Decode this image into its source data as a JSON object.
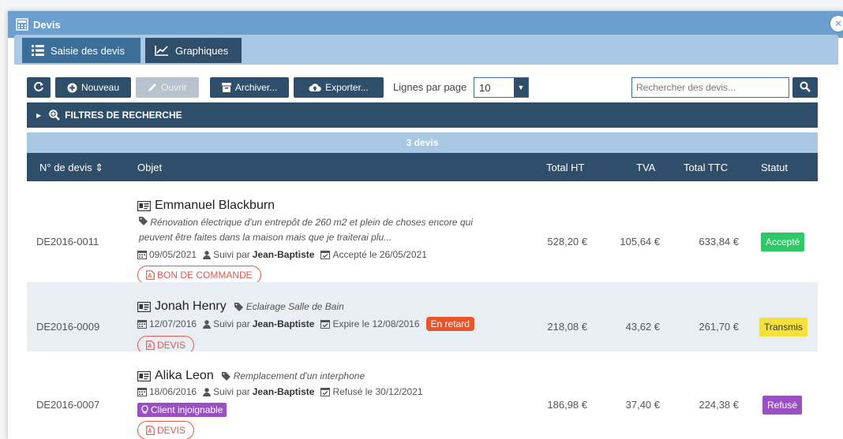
{
  "window": {
    "title": "Devis",
    "close_glyph": "✕"
  },
  "tabs": [
    {
      "label": "Saisie des devis",
      "icon": "list-icon",
      "active": true
    },
    {
      "label": "Graphiques",
      "icon": "line-chart-icon",
      "active": false
    }
  ],
  "toolbar": {
    "nouveau": "Nouveau",
    "ouvrir": "Ouvrir",
    "archiver": "Archiver...",
    "exporter": "Exporter...",
    "lignes_label": "Lignes par page",
    "lignes_value": "10",
    "search_placeholder": "Rechercher des devis..."
  },
  "filters": {
    "label": "Filtres de recherche"
  },
  "count": "3 devis",
  "columns": {
    "num": "N° de devis ⇕",
    "objet": "Objet",
    "total_ht": "Total HT",
    "tva": "TVA",
    "total_ttc": "Total TTC",
    "statut": "Statut"
  },
  "rows": [
    {
      "num": "DE2016-0011",
      "client": "Emmanuel Blackburn",
      "desc_line1": "Rénovation électrique d'un entrepôt de 260 m2 et plein de choses encore qui",
      "desc_line2": "peuvent être faites dans la maison mais que je traiterai plu...",
      "date": "09/05/2021",
      "suivi_label": "Suivi par",
      "suivi_name": "Jean-Baptiste",
      "state_text": "Accepté le 26/05/2021",
      "doc_label": "BON DE COMMANDE",
      "total_ht": "528,20 €",
      "tva": "105,64 €",
      "total_ttc": "633,84 €",
      "status": "Accepté",
      "status_color": "#2ec866"
    },
    {
      "num": "DE2016-0009",
      "client": "Jonah Henry",
      "desc": "Eclairage Salle de Bain",
      "date": "12/07/2016",
      "suivi_label": "Suivi par",
      "suivi_name": "Jean-Baptiste",
      "state_text": "Expire le 12/08/2016",
      "late_badge": "En retard",
      "doc_label": "DEVIS",
      "total_ht": "218,08 €",
      "tva": "43,62 €",
      "total_ttc": "261,70 €",
      "status": "Transmis",
      "status_color": "#f5e13c"
    },
    {
      "num": "DE2016-0007",
      "client": "Alika Leon",
      "desc": "Remplacement d'un interphone",
      "date": "18/06/2016",
      "suivi_label": "Suivi par",
      "suivi_name": "Jean-Baptiste",
      "state_text": "Refusé le 30/12/2021",
      "client_badge": "Client injoignable",
      "doc_label": "DEVIS",
      "total_ht": "186,98 €",
      "tva": "37,40 €",
      "total_ttc": "224,38 €",
      "status": "Refusé",
      "status_color": "#9b4fc4"
    }
  ]
}
